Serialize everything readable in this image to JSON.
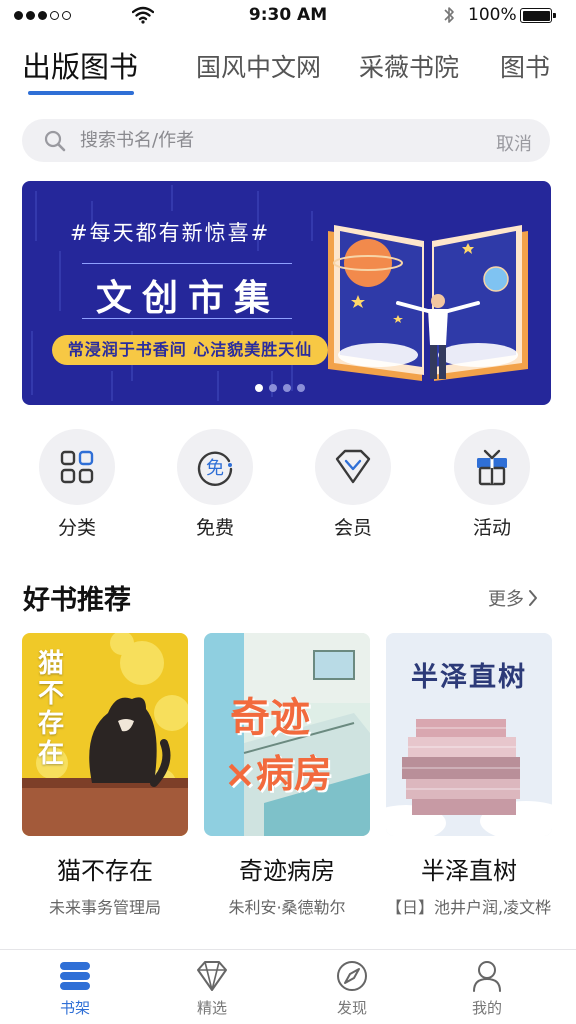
{
  "status_bar": {
    "time": "9:30 AM",
    "battery": "100%"
  },
  "tabs": [
    {
      "label": "出版图书",
      "active": true
    },
    {
      "label": "国风中文网",
      "active": false
    },
    {
      "label": "采薇书院",
      "active": false
    },
    {
      "label": "图书",
      "active": false
    }
  ],
  "search": {
    "placeholder": "搜索书名/作者",
    "cancel_label": "取消"
  },
  "banner": {
    "subtitle": "#每天都有新惊喜#",
    "title": "文创市集",
    "tagline": "常浸润于书香间 心洁貌美胜天仙",
    "page_count": 4,
    "active_page": 1
  },
  "quick_entries": [
    {
      "label": "分类",
      "icon": "grid-icon"
    },
    {
      "label": "免费",
      "icon": "free-icon"
    },
    {
      "label": "会员",
      "icon": "diamond-icon"
    },
    {
      "label": "活动",
      "icon": "gift-icon"
    }
  ],
  "recommend": {
    "title": "好书推荐",
    "more_label": "更多"
  },
  "books": [
    {
      "title": "猫不存在",
      "author": "未来事务管理局",
      "cover_text": "猫不存在"
    },
    {
      "title": "奇迹病房",
      "author": "朱利安·桑德勒尔",
      "cover_text_1": "奇迹",
      "cover_text_2": "×病房"
    },
    {
      "title": "半泽直树",
      "author": "【日】池井户润,凌文桦,",
      "cover_text": "半泽直树"
    }
  ],
  "bottom_nav": [
    {
      "label": "书架",
      "icon": "bookshelf-icon",
      "active": true
    },
    {
      "label": "精选",
      "icon": "diamond-icon",
      "active": false
    },
    {
      "label": "发现",
      "icon": "compass-icon",
      "active": false
    },
    {
      "label": "我的",
      "icon": "user-icon",
      "active": false
    }
  ],
  "colors": {
    "accent": "#2f6fd6",
    "banner_bg": "#25279a",
    "banner_tagline_bg": "#f7c844"
  }
}
